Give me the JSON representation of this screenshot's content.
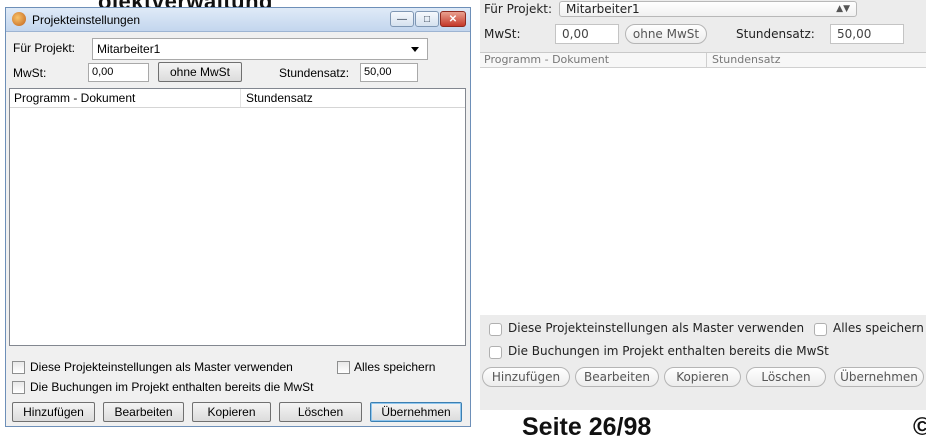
{
  "page": {
    "heading_fragment": "ojektverwaltung",
    "footer": "Seite 26/98",
    "footer_copyright": "©"
  },
  "windows_dialog": {
    "title": "Projekteinstellungen",
    "project_label": "Für Projekt:",
    "project_value": "Mitarbeiter1",
    "mwst_label": "MwSt:",
    "mwst_value": "0,00",
    "ohne_mwst_button": "ohne MwSt",
    "stundensatz_label": "Stundensatz:",
    "stundensatz_value": "50,00",
    "table_headers": [
      "Programm - Dokument",
      "Stundensatz"
    ],
    "checkbox_master": "Diese Projekteinstellungen als Master verwenden",
    "checkbox_save_all": "Alles speichern",
    "checkbox_mwst_included": "Die Buchungen im Projekt enthalten bereits die MwSt",
    "buttons": [
      "Hinzufügen",
      "Bearbeiten",
      "Kopieren",
      "Löschen",
      "Übernehmen"
    ]
  },
  "mac_dialog": {
    "project_label": "Für Projekt:",
    "project_value": "Mitarbeiter1",
    "mwst_label": "MwSt:",
    "mwst_value": "0,00",
    "ohne_mwst_button": "ohne MwSt",
    "stundensatz_label": "Stundensatz:",
    "stundensatz_value": "50,00",
    "table_headers": [
      "Programm - Dokument",
      "Stundensatz"
    ],
    "checkbox_master": "Diese Projekteinstellungen als Master verwenden",
    "checkbox_save_all": "Alles speichern",
    "checkbox_mwst_included": "Die Buchungen im Projekt enthalten bereits die MwSt",
    "buttons": [
      "Hinzufügen",
      "Bearbeiten",
      "Kopieren",
      "Löschen",
      "Übernehmen"
    ]
  }
}
